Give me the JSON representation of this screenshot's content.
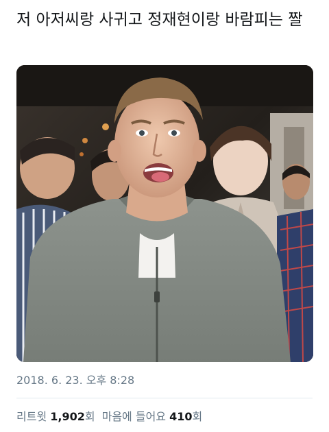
{
  "tweet": {
    "text": "저 아저씨랑 사귀고 정재현이랑 바람피는 짤",
    "timestamp": "2018. 6. 23. 오후 8:28"
  },
  "stats": {
    "retweets_label": "리트윗",
    "retweets_count": "1,902",
    "retweets_unit": "회",
    "likes_label": "마음에 들어요",
    "likes_count": "410",
    "likes_unit": "회"
  }
}
